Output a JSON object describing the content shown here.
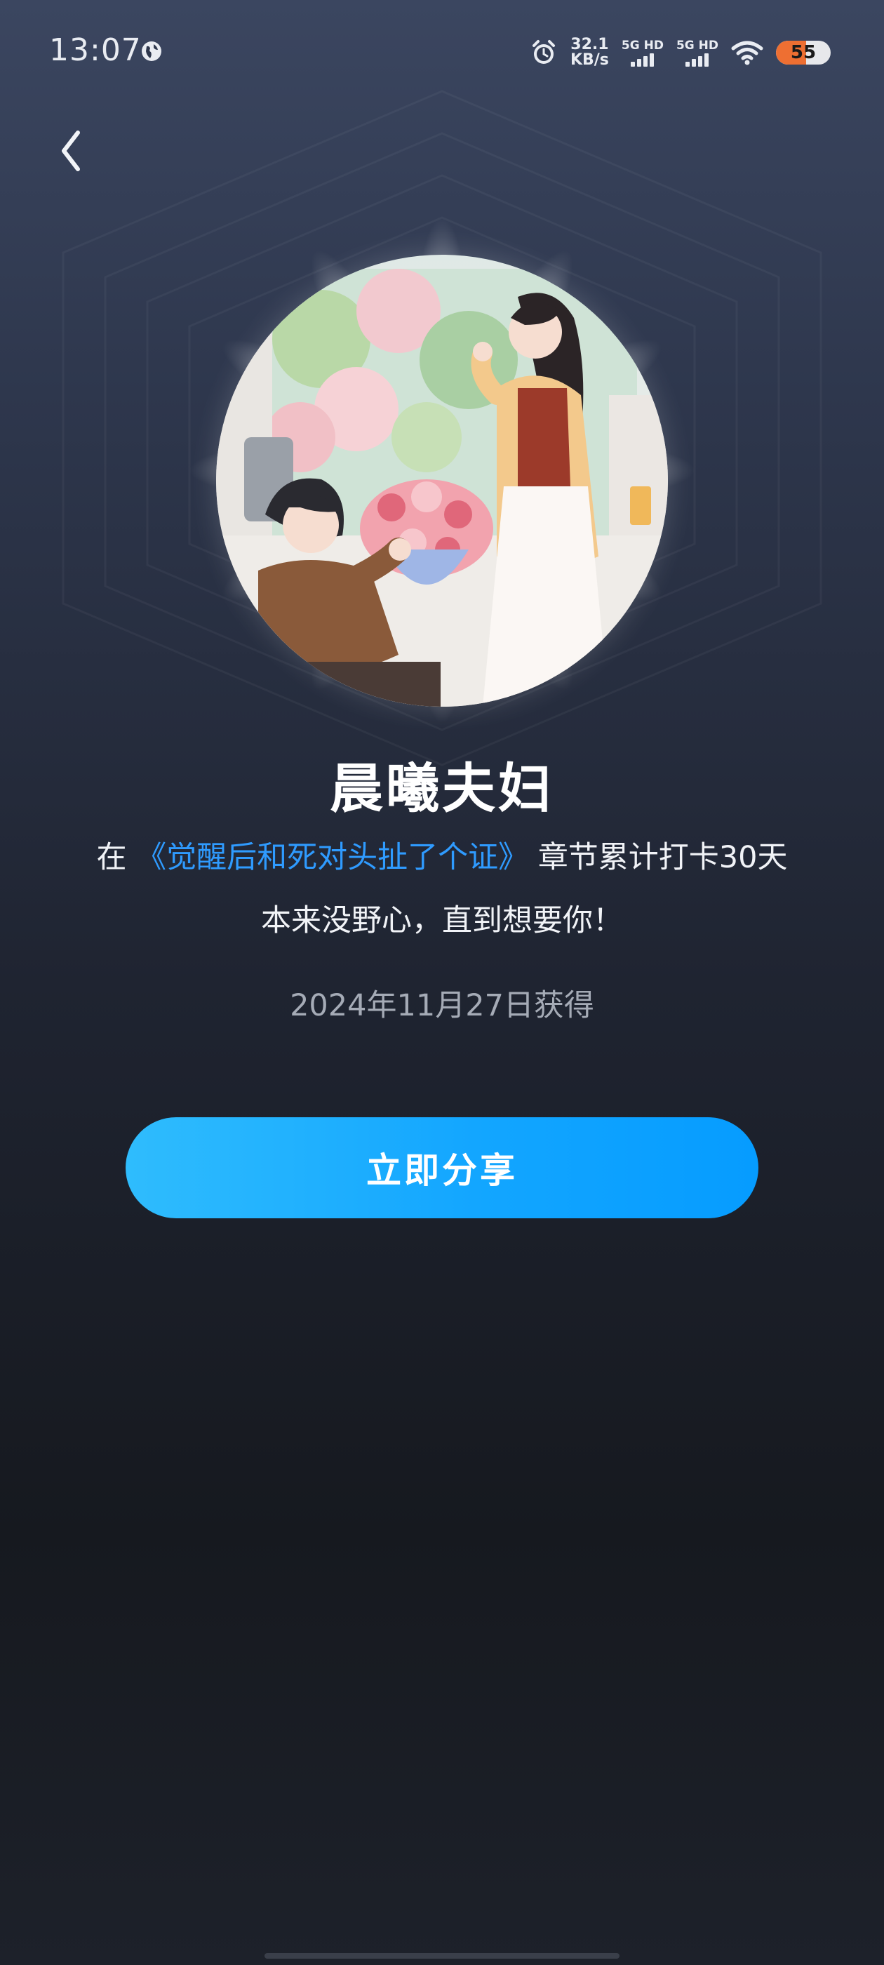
{
  "status_bar": {
    "time": "13:07",
    "net_speed_value": "32.1",
    "net_speed_unit": "KB/s",
    "sim1_label": "5G HD",
    "sim2_label": "5G HD",
    "battery": "55",
    "battery_level": 0.55
  },
  "badge": {
    "title": "晨曦夫妇",
    "desc_prefix": "在",
    "book_title": "《觉醒后和死对头扯了个证》",
    "desc_suffix": "章节累计打卡30天",
    "quote": "本来没野心，直到想要你！",
    "date": "2024年11月27日获得"
  },
  "actions": {
    "share_label": "立即分享"
  },
  "icons": {
    "back": "back-chevron-icon",
    "globe": "globe-icon",
    "alarm": "alarm-icon",
    "wifi": "wifi-icon"
  },
  "colors": {
    "accent": "#1aa8ff",
    "link": "#2f9bff",
    "battery_fill": "#ee6f32"
  }
}
